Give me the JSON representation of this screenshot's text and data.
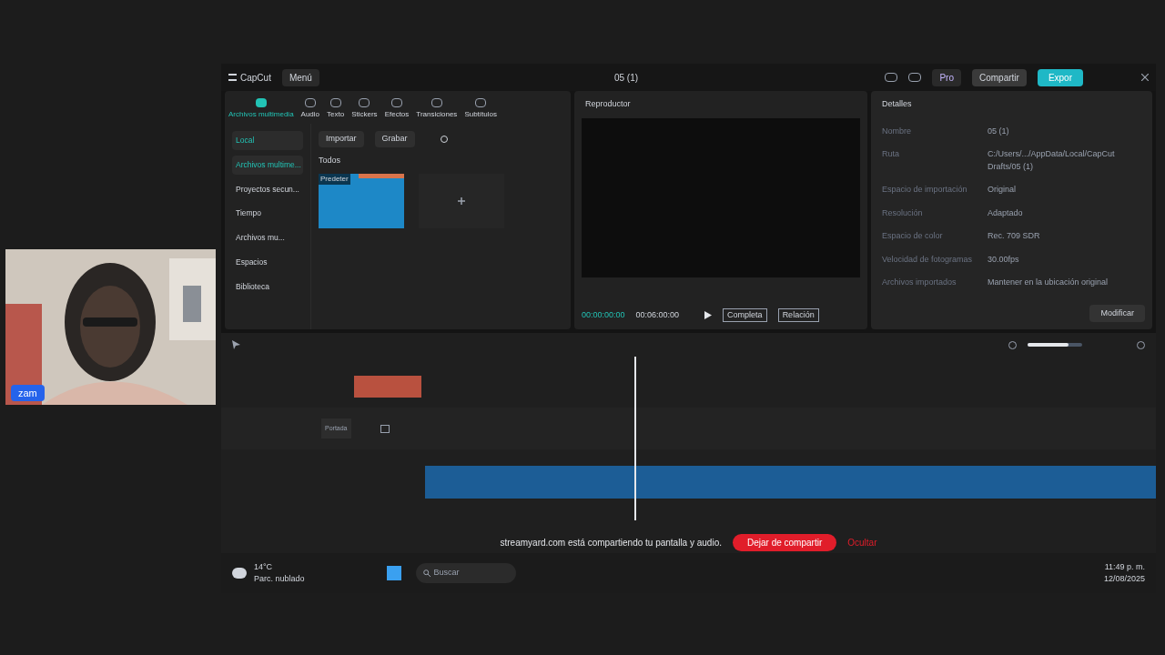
{
  "webcam": {
    "name": "zam"
  },
  "app": {
    "logo": "CapCut",
    "menu": "Menú",
    "title": "05 (1)",
    "pro": "Pro",
    "share": "Compartir",
    "export": "Expor"
  },
  "tabs": [
    {
      "label": "Archivos multimedia",
      "selected": true
    },
    {
      "label": "Audio",
      "selected": false
    },
    {
      "label": "Texto",
      "selected": false
    },
    {
      "label": "Stickers",
      "selected": false
    },
    {
      "label": "Efectos",
      "selected": false
    },
    {
      "label": "Transiciones",
      "selected": false
    },
    {
      "label": "Subtítulos",
      "selected": false
    }
  ],
  "sidebar": {
    "items": [
      {
        "label": "Local",
        "selected": true
      },
      {
        "label": "Archivos multime...",
        "selected": true
      },
      {
        "label": "Proyectos secun...",
        "selected": false
      },
      {
        "label": "Tiempo",
        "selected": false
      },
      {
        "label": "Archivos mu...",
        "selected": false
      },
      {
        "label": "Espacios",
        "selected": false
      },
      {
        "label": "Biblioteca",
        "selected": false
      }
    ]
  },
  "media": {
    "import": "Importar",
    "record": "Grabar",
    "filter": "Todos",
    "clip_label": "Predeter"
  },
  "player": {
    "title": "Reproductor",
    "current": "00:00:00:00",
    "total": "00:06:00:00",
    "full": "Completa",
    "ratio": "Relación"
  },
  "details": {
    "title": "Detalles",
    "rows": [
      {
        "label": "Nombre",
        "value": "05 (1)"
      },
      {
        "label": "Ruta",
        "value": "C:/Users/.../AppData/Local/CapCut Drafts/05 (1)"
      },
      {
        "label": "Espacio de importación",
        "value": "Original"
      },
      {
        "label": "Resolución",
        "value": "Adaptado"
      },
      {
        "label": "Espacio de color",
        "value": "Rec. 709 SDR"
      },
      {
        "label": "Velocidad de fotogramas",
        "value": "30.00fps"
      },
      {
        "label": "Archivos importados",
        "value": "Mantener en la ubicación original"
      }
    ],
    "button": "Modificar"
  },
  "timeline": {
    "cover": "Portada",
    "zoom": {
      "level": 0.75
    }
  },
  "share_bar": {
    "message": "streamyard.com está compartiendo tu pantalla y audio.",
    "stop": "Dejar de compartir",
    "hide": "Ocultar"
  },
  "taskbar": {
    "temp": "14°C",
    "weather": "Parc. nublado",
    "search": "Buscar",
    "time": "11:49 p. m.",
    "date": "12/08/2025"
  }
}
